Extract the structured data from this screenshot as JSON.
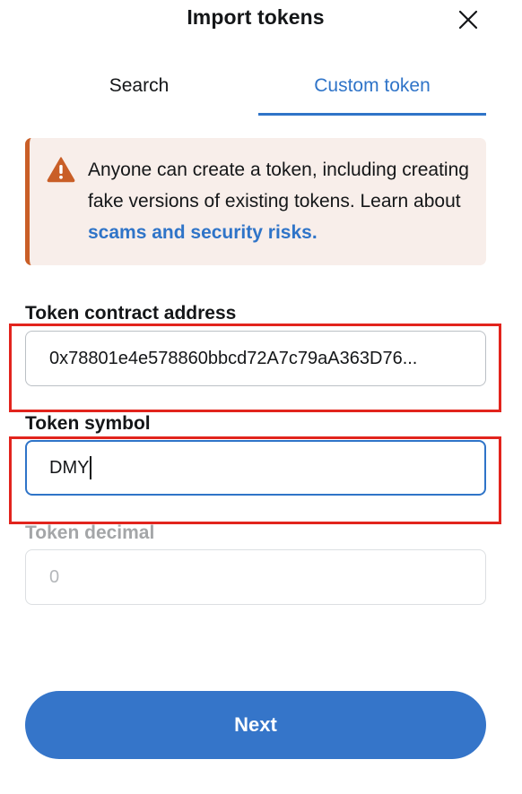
{
  "header": {
    "title": "Import tokens",
    "close_icon": "close-icon"
  },
  "tabs": [
    {
      "label": "Search",
      "active": false
    },
    {
      "label": "Custom token",
      "active": true
    }
  ],
  "alert": {
    "icon": "warning-icon",
    "text": "Anyone can create a token, including creating fake versions of existing tokens. Learn about ",
    "link_text": "scams and security risks."
  },
  "form": {
    "contract_address": {
      "label": "Token contract address",
      "value": "0x78801e4e578860bbcd72A7c79aA363D76..."
    },
    "symbol": {
      "label": "Token symbol",
      "value": "DMY"
    },
    "decimal": {
      "label": "Token decimal",
      "placeholder": "0"
    }
  },
  "footer": {
    "next_label": "Next"
  },
  "colors": {
    "accent": "#2f74c8",
    "button": "#3575c9",
    "warning": "#c95e27",
    "alert_bg": "#f8eeea",
    "highlight": "#e2241d"
  }
}
